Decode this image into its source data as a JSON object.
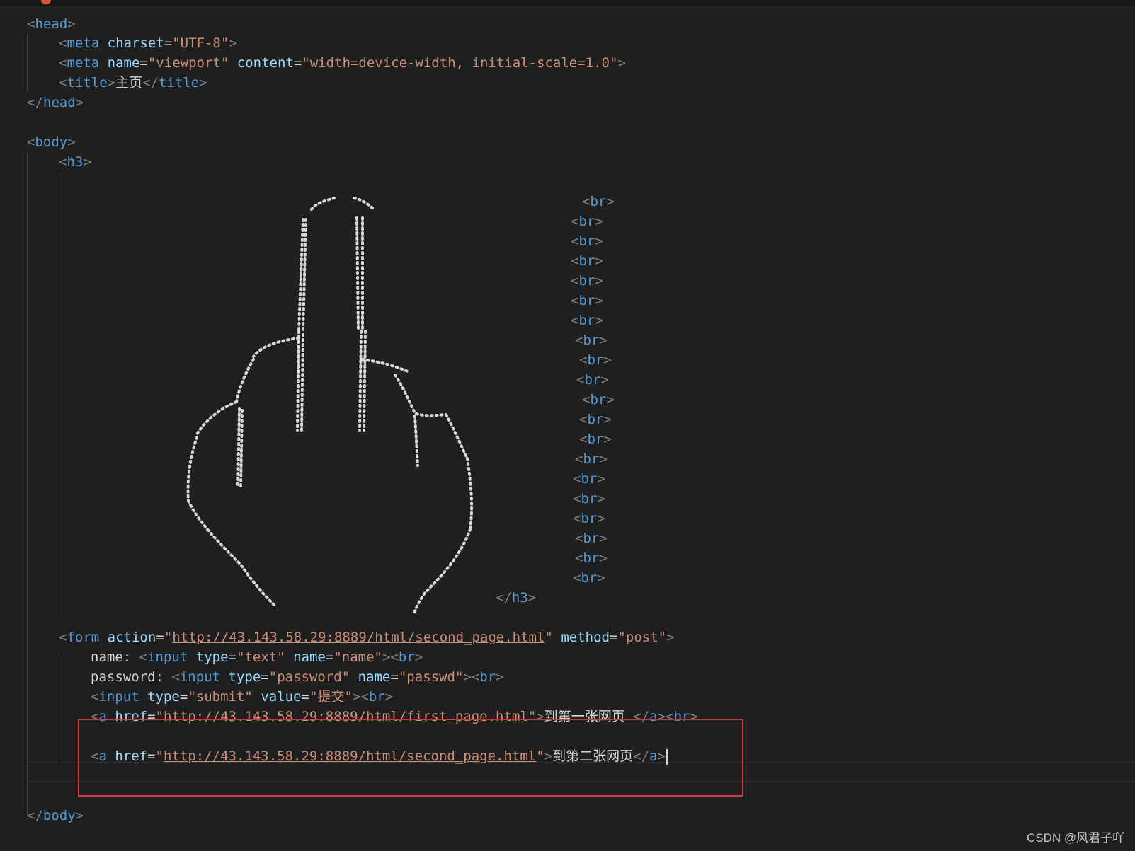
{
  "head": {
    "open": "head",
    "meta_charset": {
      "tag": "meta",
      "attr": "charset",
      "value": "UTF-8"
    },
    "meta_viewport": {
      "tag": "meta",
      "attr1": "name",
      "value1": "viewport",
      "attr2": "content",
      "value2": "width=device-width, initial-scale=1.0"
    },
    "title": {
      "tag": "title",
      "text": "主页"
    },
    "close": "head"
  },
  "body": {
    "open": "body",
    "close": "body"
  },
  "h3": {
    "open": "h3",
    "close": "h3",
    "br": "br"
  },
  "form": {
    "tag": "form",
    "action_attr": "action",
    "action": "http://43.143.58.29:8889/html/second_page.html",
    "method_attr": "method",
    "method": "post",
    "name_label": "name:",
    "password_label": "password:",
    "input_tag": "input",
    "type_attr": "type",
    "name_attr": "name",
    "value_attr": "value",
    "name_type": "text",
    "name_name": "name",
    "pass_type": "password",
    "pass_name": "passwd",
    "submit_type": "submit",
    "submit_value": "提交"
  },
  "links": [
    {
      "tag": "a",
      "href_attr": "href",
      "href": "http://43.143.58.29:8889/html/first_page.html",
      "text": "到第一张网页 "
    },
    {
      "tag": "a",
      "href_attr": "href",
      "href": "http://43.143.58.29:8889/html/second_page.html",
      "text": "到第二张网页"
    }
  ],
  "watermark": "CSDN @风君子吖",
  "colors": {
    "tag": "#569cd6",
    "attribute": "#9cdcfe",
    "string": "#ce9178",
    "punctuation": "#808080",
    "highlight_box": "#d03a3a"
  }
}
